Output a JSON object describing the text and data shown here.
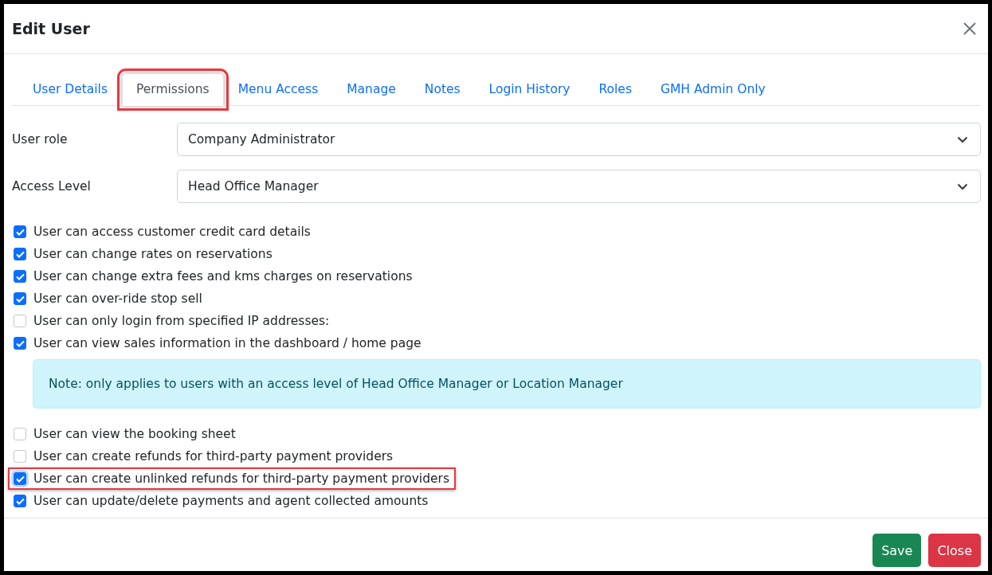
{
  "dialog": {
    "title": "Edit User"
  },
  "tabs": [
    {
      "label": "User Details",
      "selected": false,
      "highlighted": false
    },
    {
      "label": "Permissions",
      "selected": true,
      "highlighted": true
    },
    {
      "label": "Menu Access",
      "selected": false,
      "highlighted": false
    },
    {
      "label": "Manage",
      "selected": false,
      "highlighted": false
    },
    {
      "label": "Notes",
      "selected": false,
      "highlighted": false
    },
    {
      "label": "Login History",
      "selected": false,
      "highlighted": false
    },
    {
      "label": "Roles",
      "selected": false,
      "highlighted": false
    },
    {
      "label": "GMH Admin Only",
      "selected": false,
      "highlighted": false
    }
  ],
  "fields": [
    {
      "label": "User role",
      "value": "Company Administrator"
    },
    {
      "label": "Access Level",
      "value": "Head Office Manager"
    }
  ],
  "permissions": [
    {
      "kind": "checkbox",
      "label": "User can access customer credit card details",
      "checked": true,
      "highlighted": false
    },
    {
      "kind": "checkbox",
      "label": "User can change rates on reservations",
      "checked": true,
      "highlighted": false
    },
    {
      "kind": "checkbox",
      "label": "User can change extra fees and kms charges on reservations",
      "checked": true,
      "highlighted": false
    },
    {
      "kind": "checkbox",
      "label": "User can over-ride stop sell",
      "checked": true,
      "highlighted": false
    },
    {
      "kind": "checkbox",
      "label": "User can only login from specified IP addresses:",
      "checked": false,
      "highlighted": false
    },
    {
      "kind": "checkbox",
      "label": "User can view sales information in the dashboard / home page",
      "checked": true,
      "highlighted": false
    },
    {
      "kind": "note",
      "label": "Note: only applies to users with an access level of Head Office Manager or Location Manager"
    },
    {
      "kind": "checkbox",
      "label": "User can view the booking sheet",
      "checked": false,
      "highlighted": false
    },
    {
      "kind": "checkbox",
      "label": "User can create refunds for third-party payment providers",
      "checked": false,
      "highlighted": false
    },
    {
      "kind": "checkbox",
      "label": "User can create unlinked refunds for third-party payment providers",
      "checked": true,
      "highlighted": true
    },
    {
      "kind": "checkbox",
      "label": "User can update/delete payments and agent collected amounts",
      "checked": true,
      "highlighted": false
    }
  ],
  "buttons": [
    {
      "kind": "save",
      "label": "Save"
    },
    {
      "kind": "close",
      "label": "Close"
    }
  ]
}
